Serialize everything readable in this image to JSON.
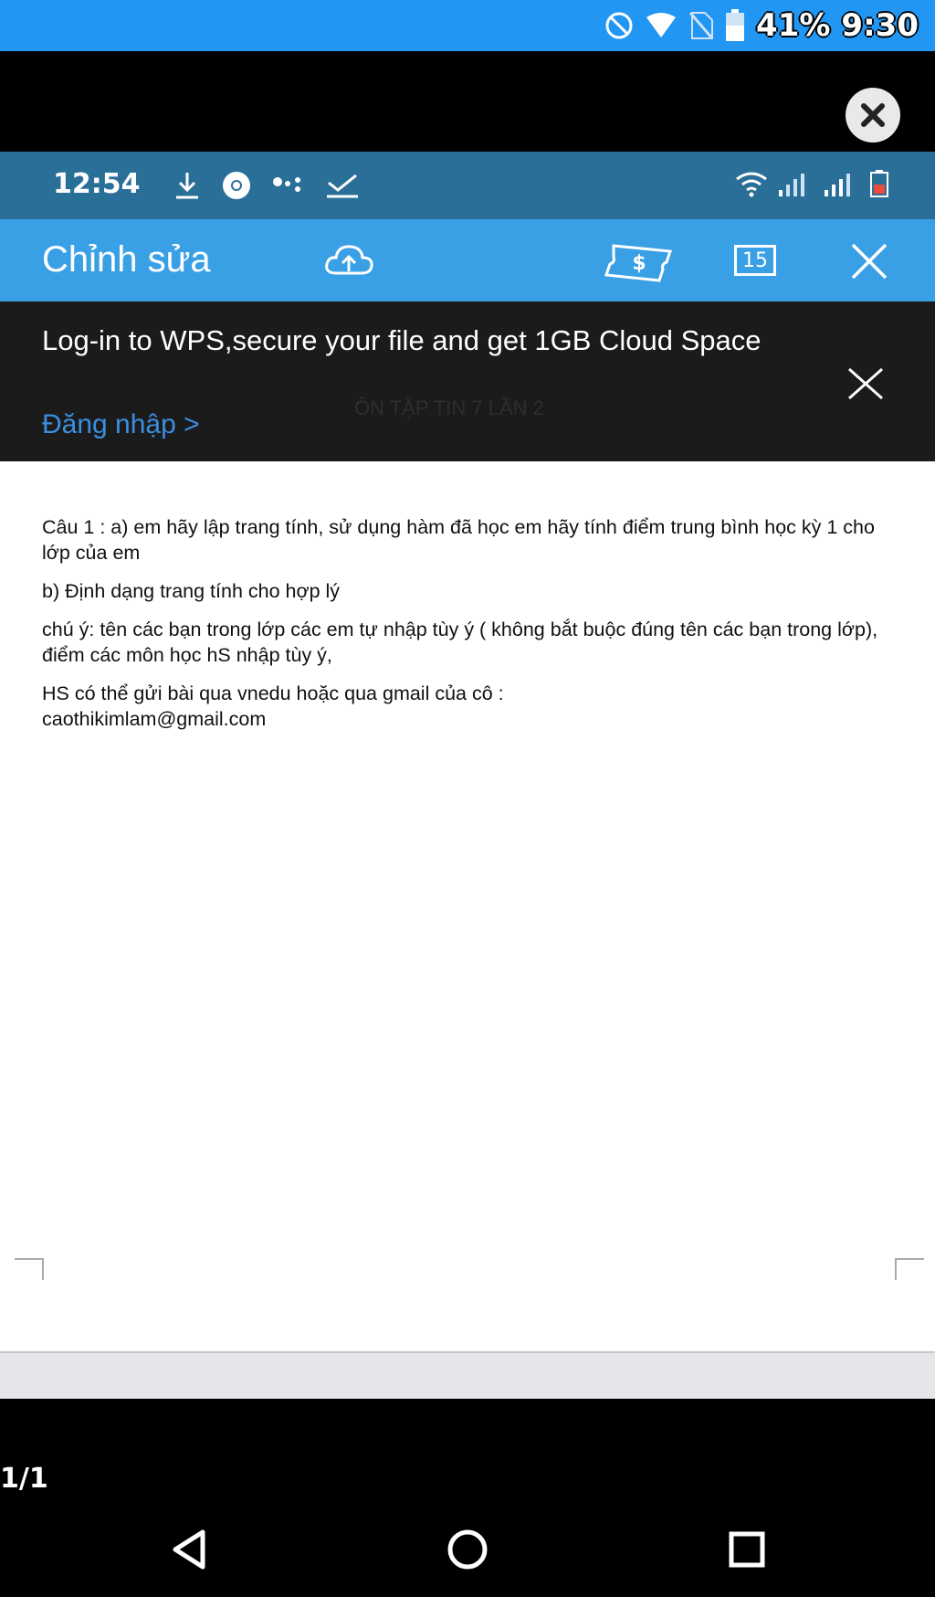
{
  "outer_status": {
    "battery_percent": "41%",
    "time": "9:30",
    "icons": [
      "do-not-disturb-icon",
      "wifi-icon",
      "no-sim-icon",
      "battery-icon"
    ]
  },
  "inner_status": {
    "time": "12:54",
    "icons_left": [
      "download-icon",
      "chrome-icon",
      "app-dots-icon",
      "check-icon"
    ],
    "icons_right": [
      "wifi-icon",
      "signal-icon",
      "signal-icon",
      "battery-icon"
    ]
  },
  "toolbar": {
    "title": "Chỉnh sửa",
    "calendar_number": "15",
    "icons": [
      "cloud-upload-icon",
      "ticket-dollar-icon",
      "calendar-icon",
      "close-icon"
    ]
  },
  "banner": {
    "message": "Log-in to WPS,secure your file and get 1GB Cloud Space",
    "login_link": "Đăng nhập >",
    "behind_title": "ÔN TẬP TIN 7 LẦN 2"
  },
  "document": {
    "paragraphs": [
      "Câu 1 : a) em hãy lập trang tính, sử dụng hàm đã học em hãy tính điểm trung bình học kỳ 1 cho lớp của em",
      "b) Định dạng trang tính cho hợp lý",
      "chú ý: tên các bạn trong lớp các em tự nhập tùy ý ( không bắt buộc đúng tên các bạn trong lớp), điểm các môn học hS nhập tùy ý,",
      "HS có thể gửi bài qua vnedu hoặc qua gmail của cô : caothikimlam@gmail.com"
    ]
  },
  "footer": {
    "page_counter": "1/1",
    "nav": [
      "back-icon",
      "home-icon",
      "recents-icon"
    ]
  },
  "colors": {
    "status_blue": "#2196f3",
    "inner_status": "#2a6f98",
    "toolbar": "#3aa0e6",
    "banner_bg": "#1b1b1b",
    "link_blue": "#3b8fe0"
  }
}
